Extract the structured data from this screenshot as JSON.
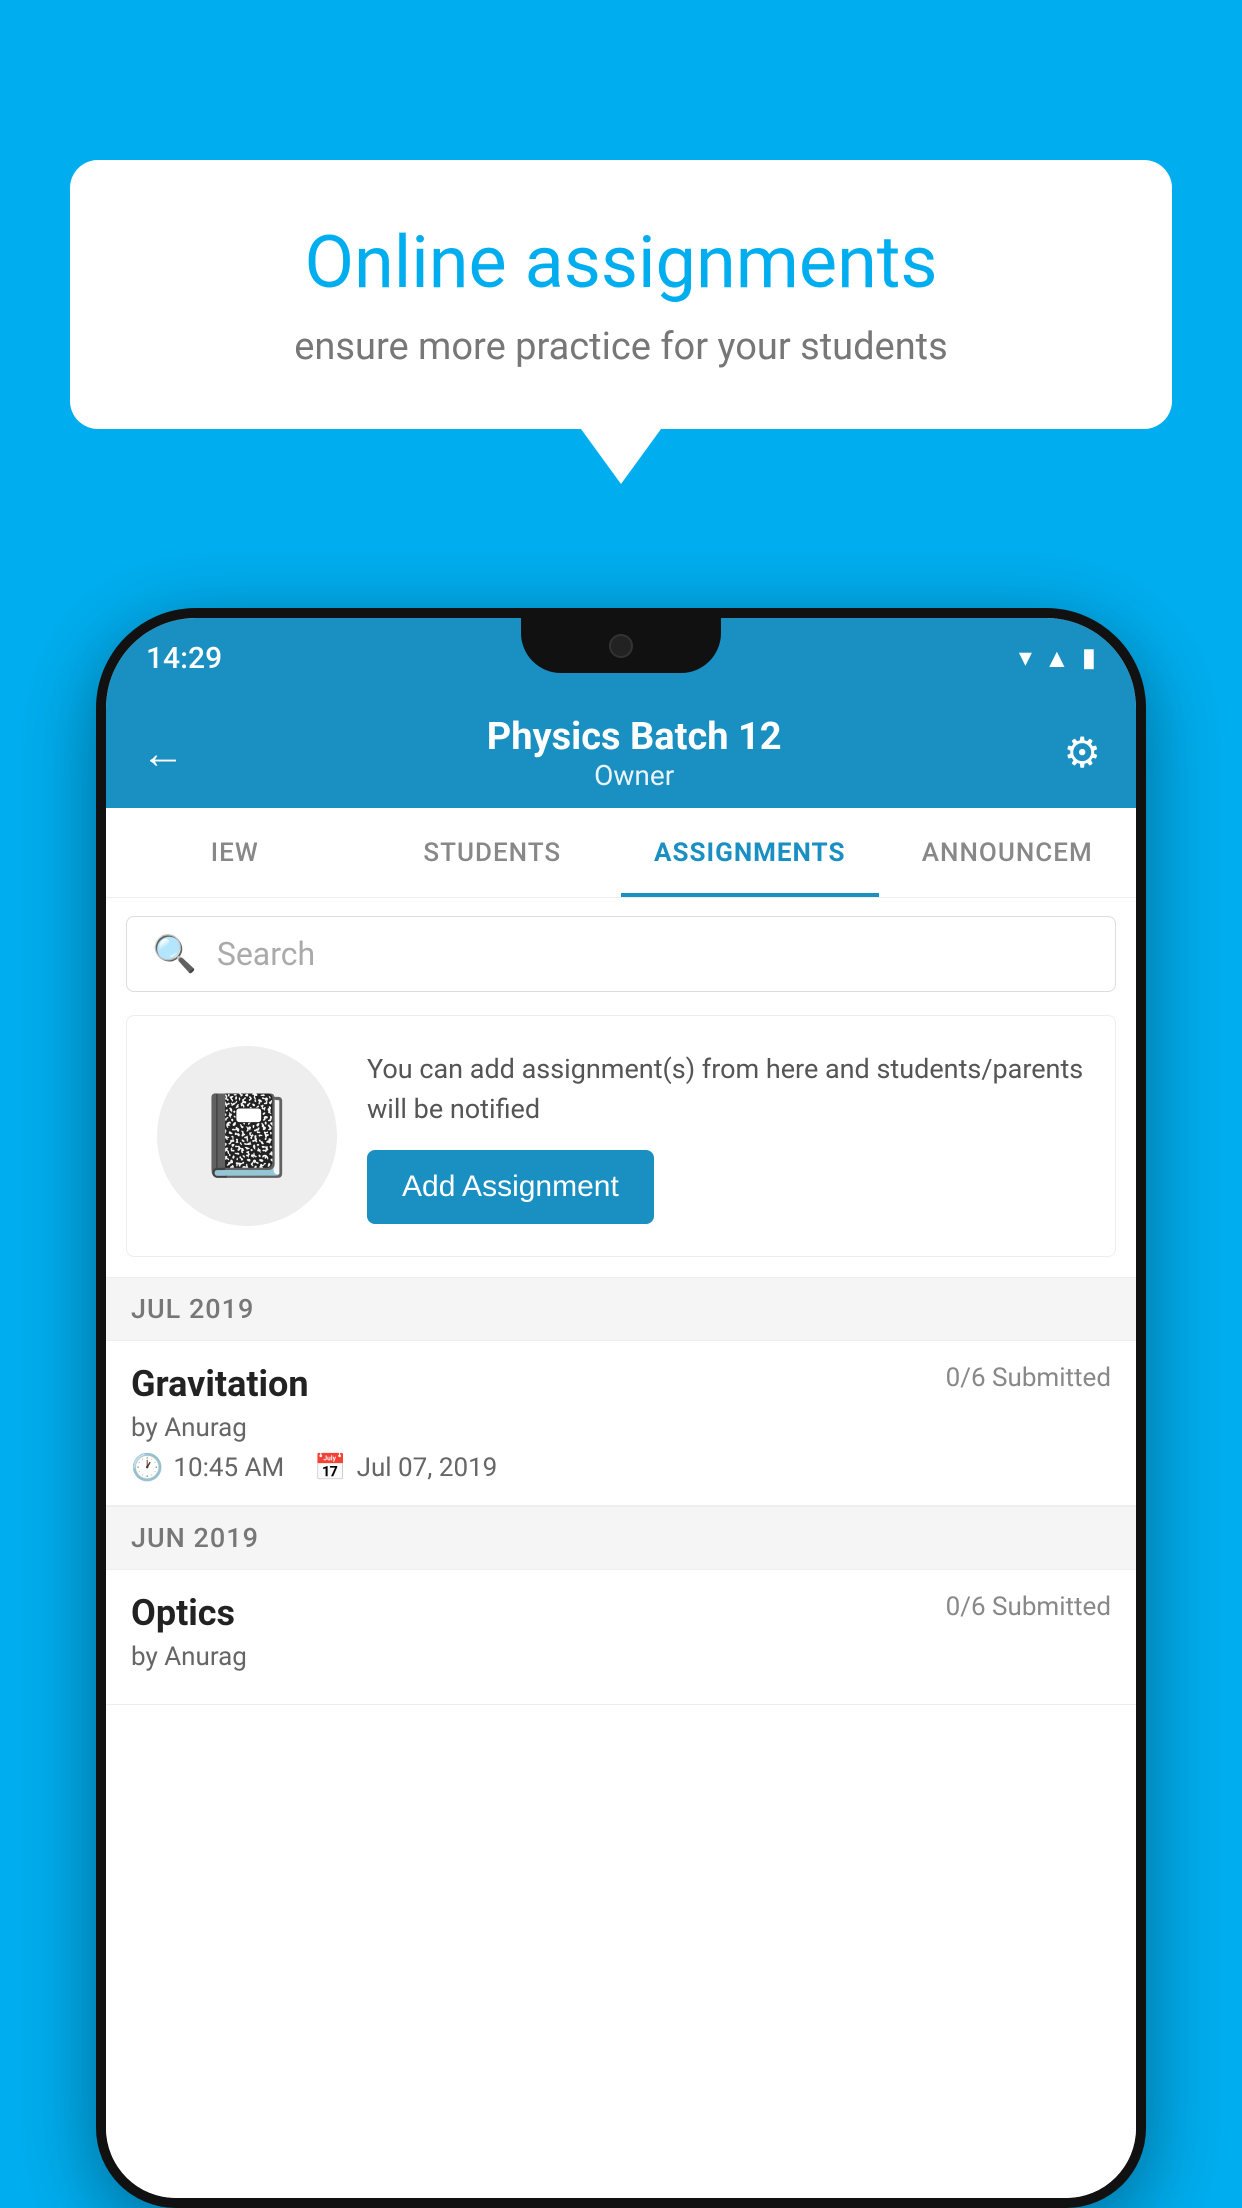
{
  "background_color": "#00AEEF",
  "speech_bubble": {
    "title": "Online assignments",
    "subtitle": "ensure more practice for your students"
  },
  "status_bar": {
    "time": "14:29",
    "icons": [
      "wifi",
      "signal",
      "battery"
    ]
  },
  "app_bar": {
    "title": "Physics Batch 12",
    "subtitle": "Owner",
    "back_label": "←",
    "settings_label": "⚙"
  },
  "tabs": [
    {
      "label": "IEW",
      "active": false
    },
    {
      "label": "STUDENTS",
      "active": false
    },
    {
      "label": "ASSIGNMENTS",
      "active": true
    },
    {
      "label": "ANNOUNCEM",
      "active": false
    }
  ],
  "search": {
    "placeholder": "Search"
  },
  "empty_state": {
    "description": "You can add assignment(s) from here and students/parents will be notified",
    "add_button_label": "Add Assignment",
    "icon": "📓"
  },
  "sections": [
    {
      "header": "JUL 2019",
      "assignments": [
        {
          "title": "Gravitation",
          "submitted": "0/6 Submitted",
          "author": "by Anurag",
          "time": "10:45 AM",
          "date": "Jul 07, 2019"
        }
      ]
    },
    {
      "header": "JUN 2019",
      "assignments": [
        {
          "title": "Optics",
          "submitted": "0/6 Submitted",
          "author": "by Anurag",
          "time": "",
          "date": ""
        }
      ]
    }
  ]
}
